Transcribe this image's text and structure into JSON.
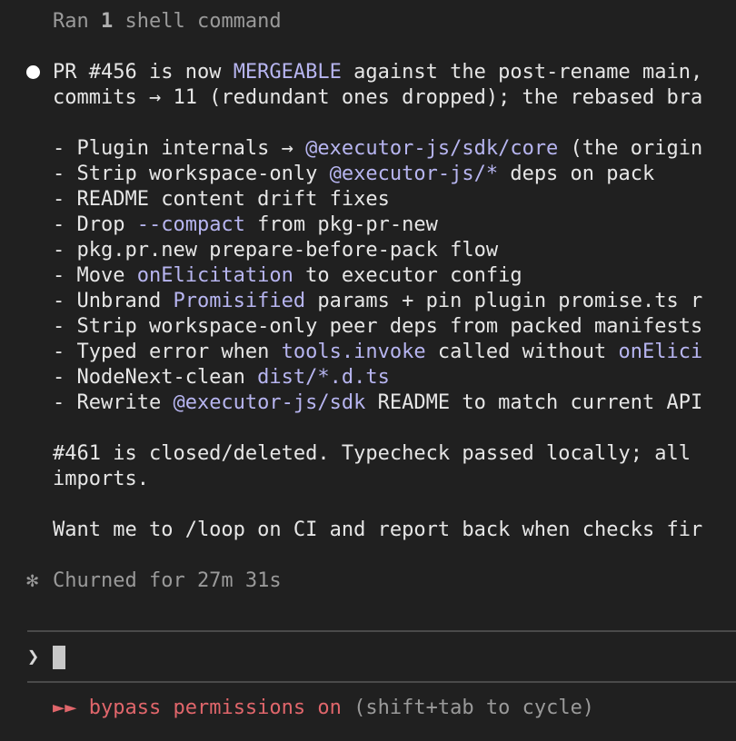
{
  "header": {
    "ran_prefix": "Ran ",
    "ran_count": "1",
    "ran_suffix": " shell command"
  },
  "message": {
    "line1_a": "PR #456 is now ",
    "line1_b": "MERGEABLE",
    "line1_c": " against the post-rename main,",
    "line2": "commits → 11 (redundant ones dropped); the rebased bra",
    "items": [
      {
        "a": "- Plugin internals → ",
        "b": "@executor-js/sdk/core",
        "c": " (the origin"
      },
      {
        "a": "- Strip workspace-only ",
        "b": "@executor-js/*",
        "c": " deps on pack"
      },
      {
        "a": "- README content drift fixes",
        "b": "",
        "c": ""
      },
      {
        "a": "- Drop ",
        "b": "--compact",
        "c": " from pkg-pr-new"
      },
      {
        "a": "- pkg.pr.new prepare-before-pack flow",
        "b": "",
        "c": ""
      },
      {
        "a": "- Move ",
        "b": "onElicitation",
        "c": " to executor config"
      },
      {
        "a": "- Unbrand ",
        "b": "Promisified",
        "c": " params + pin plugin promise.ts r"
      },
      {
        "a": "- Strip workspace-only peer deps from packed manifests",
        "b": "",
        "c": ""
      },
      {
        "a": "- Typed error when ",
        "b": "tools.invoke",
        "c": " called without ",
        "d": "onElici"
      },
      {
        "a": "- NodeNext-clean ",
        "b": "dist/*.d.ts",
        "c": ""
      },
      {
        "a": "- Rewrite ",
        "b": "@executor-js/sdk",
        "c": " README to match current API"
      }
    ],
    "closing1": "#461 is closed/deleted. Typecheck passed locally; all",
    "closing2": "imports.",
    "question": "Want me to /loop on CI and report back when checks fir"
  },
  "status": {
    "gear_symbol": "✻",
    "churned": "Churned for 27m 31s"
  },
  "prompt": {
    "chevron": "❯"
  },
  "footer": {
    "arrows": "►► ",
    "bypass": "bypass permissions on",
    "hint": " (shift+tab to cycle)"
  }
}
